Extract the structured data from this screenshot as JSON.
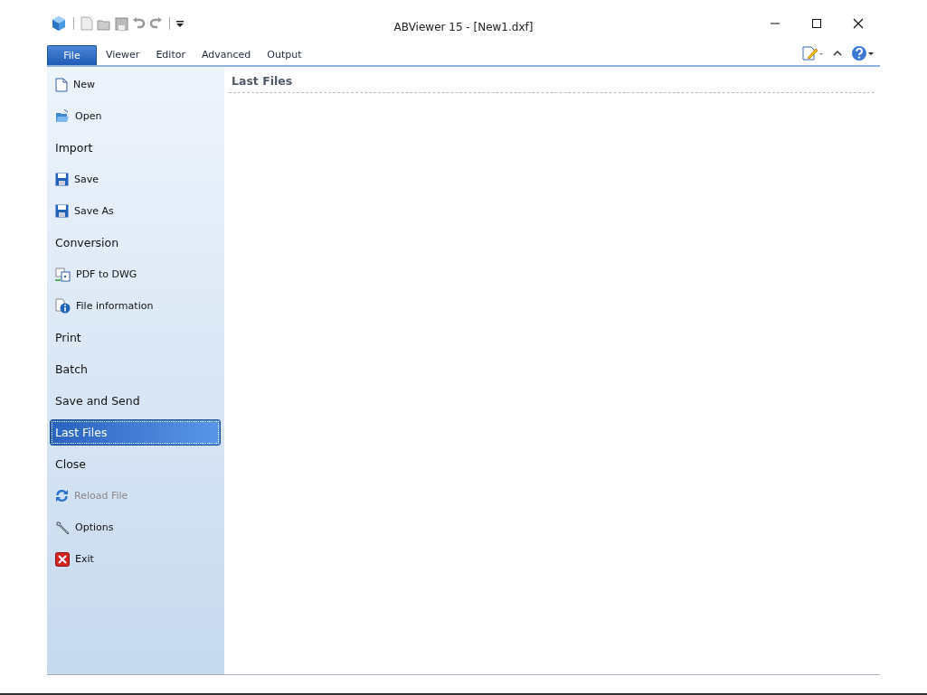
{
  "window": {
    "title": "ABViewer 15 - [New1.dxf]"
  },
  "tabs": [
    {
      "label": "File",
      "selected": true
    },
    {
      "label": "Viewer",
      "selected": false
    },
    {
      "label": "Editor",
      "selected": false
    },
    {
      "label": "Advanced",
      "selected": false
    },
    {
      "label": "Output",
      "selected": false
    }
  ],
  "menu": [
    {
      "label": "New",
      "kind": "command",
      "selected": false,
      "disabled": false
    },
    {
      "label": "Open",
      "kind": "command",
      "selected": false,
      "disabled": false
    },
    {
      "label": "Import",
      "kind": "page",
      "selected": false,
      "disabled": false
    },
    {
      "label": "Save",
      "kind": "command",
      "selected": false,
      "disabled": false
    },
    {
      "label": "Save As",
      "kind": "command",
      "selected": false,
      "disabled": false
    },
    {
      "label": "Conversion",
      "kind": "page",
      "selected": false,
      "disabled": false
    },
    {
      "label": "PDF to DWG",
      "kind": "command",
      "selected": false,
      "disabled": false
    },
    {
      "label": "File information",
      "kind": "command",
      "selected": false,
      "disabled": false
    },
    {
      "label": "Print",
      "kind": "page",
      "selected": false,
      "disabled": false
    },
    {
      "label": "Batch",
      "kind": "page",
      "selected": false,
      "disabled": false
    },
    {
      "label": "Save and Send",
      "kind": "page",
      "selected": false,
      "disabled": false
    },
    {
      "label": "Last Files",
      "kind": "page",
      "selected": true,
      "disabled": false
    },
    {
      "label": "Close",
      "kind": "page",
      "selected": false,
      "disabled": false
    },
    {
      "label": "Reload File",
      "kind": "command",
      "selected": false,
      "disabled": true
    },
    {
      "label": "Options",
      "kind": "command",
      "selected": false,
      "disabled": false
    },
    {
      "label": "Exit",
      "kind": "command",
      "selected": false,
      "disabled": false
    }
  ],
  "content": {
    "heading": "Last Files"
  }
}
